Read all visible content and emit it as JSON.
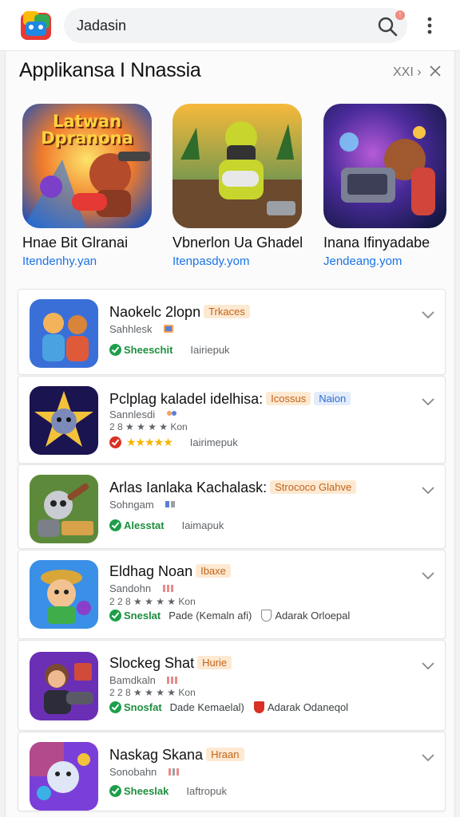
{
  "search": {
    "query": "Jadasin"
  },
  "section": {
    "title": "Applikansa I Nnassia",
    "more": "XXI ›"
  },
  "featured": [
    {
      "banner": "Latwan Dpranona",
      "name": "Hnae Bit Glranai",
      "developer": "Itendenhy.yan"
    },
    {
      "name": "Vbnerlon Ua Ghadel",
      "developer": "Itenpasdy.yom"
    },
    {
      "name": "Inana Ifinyadabe",
      "developer": "Jendeang.yom"
    }
  ],
  "apps": [
    {
      "title": "Naokelc 2lopn",
      "tag": "Trkaces",
      "sub": "Sahhlesk",
      "meta_status": "Sheeschit",
      "meta_label": "Iairiepuk"
    },
    {
      "title": "Pclplag kaladel idelhisa:",
      "tag": "Icossus",
      "tag2": "Naion",
      "sub": "Sannlesdi",
      "rating": "2 8 ★ ★ ★ ★ Kon",
      "stars": "★★★★★",
      "meta_label": "Iairimepuk"
    },
    {
      "title": "Arlas Ianlaka Kachalask:",
      "tag": "Strococo Glahve",
      "sub": "Sohngam",
      "meta_status": "Alesstat",
      "meta_label": "Iaimapuk"
    },
    {
      "title": "Eldhag Noan",
      "tag": "Ibaxe",
      "sub": "Sandohn",
      "rating": "2 2 8 ★ ★ ★ ★ Kon",
      "meta_status": "Sneslat",
      "meta_extra": "Pade (Kemaln afi)",
      "meta_extra2": "Adarak Orloepal"
    },
    {
      "title": "Slockeg Shat",
      "tag": "Hurie",
      "sub": "Bamdkaln",
      "rating": "2 2 8 ★ ★ ★ ★ Kon",
      "meta_status": "Snosfat",
      "meta_extra": "Dade Kemaelal)",
      "meta_extra2": "Adarak Odaneqol"
    },
    {
      "title": "Naskag Skana",
      "tag": "Hraan",
      "sub": "Sonobahn",
      "meta_status": "Sheeslak",
      "meta_label": "Iaftropuk"
    }
  ],
  "colors": {
    "accent": "#1a73e8",
    "verified": "#1e9e4a",
    "tag_bg": "#fde9d2"
  }
}
